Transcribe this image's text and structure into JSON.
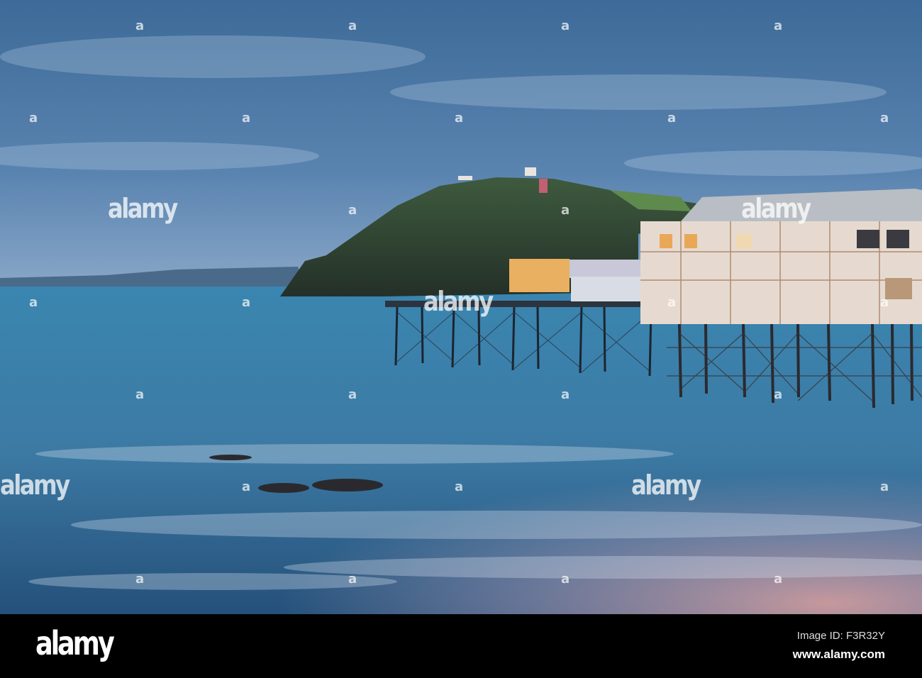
{
  "photo": {
    "subject": "Pier and headland at dusk",
    "colors": {
      "sky_top": "#3d6a98",
      "sky_horizon": "#8aa8c8",
      "sea": "#3a80aa",
      "sea_dark": "#24507a",
      "glow": "#c9a0a8",
      "headland": "#2c3a2e",
      "pavilion": "#e6dad0",
      "roof": "#b9bec4",
      "lights": "#f5d27a"
    }
  },
  "watermark": {
    "text": "alamy",
    "mark": "a"
  },
  "footer": {
    "logo": "alamy",
    "image_id": "Image ID: F3R32Y",
    "url": "www.alamy.com"
  }
}
